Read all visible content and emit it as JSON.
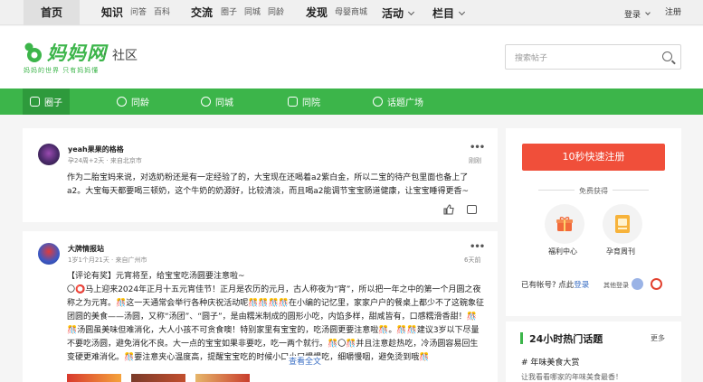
{
  "topnav": {
    "home": "首页",
    "knowledge": "知识",
    "wenda": "问答",
    "baike": "百科",
    "exchange": "交流",
    "quanzi": "圈子",
    "tongcheng": "同城",
    "tongling": "同龄",
    "discover": "发现",
    "mall": "母婴商城",
    "activity": "活动",
    "column": "栏目",
    "login": "登录",
    "register": "注册"
  },
  "logo": {
    "title": "妈妈网",
    "tagline": "妈妈的世界 只有妈妈懂",
    "dot": "·",
    "section": "社区"
  },
  "search": {
    "placeholder": "搜索帖子"
  },
  "subnav": [
    "圈子",
    "同龄",
    "同城",
    "同院",
    "话题广场"
  ],
  "posts": [
    {
      "author": "yeah果果的格格",
      "meta": "孕24周+2天 · 来自北京市",
      "more": "•••",
      "tag": "刚刚",
      "text": "作为二胎宝妈来说，对选奶粉还是有一定经验了的，大宝现在还喝着a2紫白金，所以二宝的待产包里面也备上了a2。大宝每天都要喝三顿奶，这个牛奶的奶源好，比较清淡，而且喝a2能调节宝宝肠道健康，让宝宝睡得更香~"
    },
    {
      "author": "大牌情报站",
      "meta": "1岁1个月21天 · 来自广州市",
      "more": "•••",
      "tag": "6天前",
      "text": "【评论有奖】元宵将至，给宝宝吃汤圆要注意啦~\n〇⭕马上迎来2024年正月十五元宵佳节！正月是农历的元月，古人称夜为“宵”，所以把一年之中的第一个月圆之夜称之为元宵。🎊这一天通常会举行各种庆祝活动呢🎊🎊🎊🎊在小编的记忆里，家家户户的餐桌上都少不了这碗象征团圆的美食——汤圆，又称“汤团”、“圆子”，是由糯米制成的圆形小吃，内馅多样，甜咸皆有，口感糯滑香甜！🎊🎊汤圆虽美味但难消化，大人小孩不可贪食噢！特别家里有宝宝的，吃汤圆更要注意啦🎊。🎊🎊建议3岁以下尽量不要吃汤圆，避免消化不良。大一点的宝宝如果非要吃，吃一两个就行。🎊〇🎊并且注意趁热吃，冷汤圆容易回生变硬更难消化。🎊要注意夹心温度高，提醒宝宝吃的时候小口小口慢慢吃，细嚼慢咽，避免烫到哦🎊",
      "view_all": "查看全文"
    }
  ],
  "sidebar": {
    "register_btn": "10秒快速注册",
    "free_label": "免费获得",
    "benefit1": "福利中心",
    "benefit2": "孕育周刊",
    "have_account": "已有帐号? 点此",
    "login_link": "登录",
    "other_login": "其他登录"
  },
  "hot": {
    "title": "24小时热门话题",
    "more": "更多",
    "item1": "# 年味美食大赏",
    "item2": "让我看看哪家的年味美食最香！"
  },
  "colors": {
    "brand_green": "#3cb54a",
    "register_red": "#f04f3a",
    "link_blue": "#3b6fc4"
  }
}
